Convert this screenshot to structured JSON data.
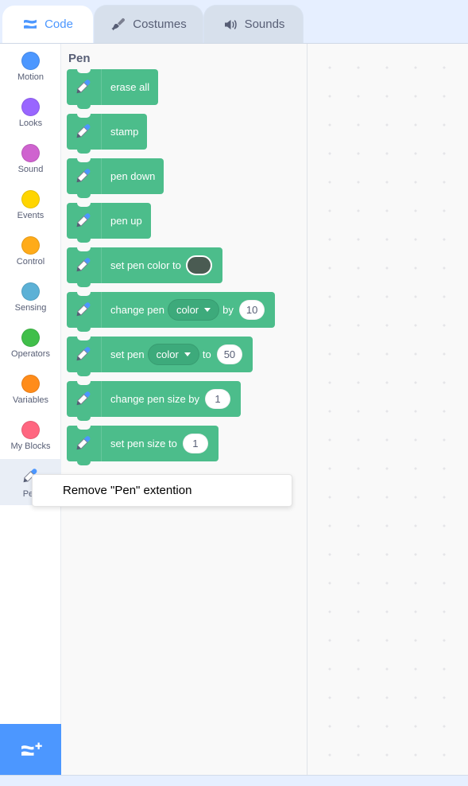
{
  "window": {
    "top_bar_color": "#e6efff",
    "accent_color": "#4c97ff",
    "pen_block_color": "#4cbd8b"
  },
  "tabs": [
    {
      "label": "Code",
      "icon": "code-blocks-icon",
      "active": true
    },
    {
      "label": "Costumes",
      "icon": "paintbrush-icon",
      "active": false
    },
    {
      "label": "Sounds",
      "icon": "speaker-icon",
      "active": false
    }
  ],
  "categories": [
    {
      "label": "Motion",
      "color": "#4c97ff",
      "icon": "circle-icon",
      "selected": false
    },
    {
      "label": "Looks",
      "color": "#9966ff",
      "icon": "circle-icon",
      "selected": false
    },
    {
      "label": "Sound",
      "color": "#cf63cf",
      "icon": "circle-icon",
      "selected": false
    },
    {
      "label": "Events",
      "color": "#ffd500",
      "icon": "circle-icon",
      "selected": false
    },
    {
      "label": "Control",
      "color": "#ffab19",
      "icon": "circle-icon",
      "selected": false
    },
    {
      "label": "Sensing",
      "color": "#5cb1d6",
      "icon": "circle-icon",
      "selected": false
    },
    {
      "label": "Operators",
      "color": "#40bf4a",
      "icon": "circle-icon",
      "selected": false
    },
    {
      "label": "Variables",
      "color": "#ff8c1a",
      "icon": "circle-icon",
      "selected": false
    },
    {
      "label": "My Blocks",
      "color": "#ff6680",
      "icon": "circle-icon",
      "selected": false
    },
    {
      "label": "Pen",
      "color": "#4cbd8b",
      "icon": "pen-icon",
      "selected": true
    }
  ],
  "add_extension_button": {
    "icon": "add-extension-icon",
    "label": ""
  },
  "palette": {
    "title": "Pen",
    "blocks": [
      {
        "name": "erase-all",
        "label": "erase all"
      },
      {
        "name": "stamp",
        "label": "stamp"
      },
      {
        "name": "pen-down",
        "label": "pen down"
      },
      {
        "name": "pen-up",
        "label": "pen up"
      },
      {
        "name": "set-pen-color-to",
        "label": "set pen color to",
        "swatch": "#4a5b52"
      },
      {
        "name": "change-pen-by",
        "label_a": "change pen",
        "dropdown": "color",
        "label_b": "by",
        "value": "10"
      },
      {
        "name": "set-pen-to",
        "label_a": "set pen",
        "dropdown": "color",
        "label_b": "to",
        "value": "50"
      },
      {
        "name": "change-pen-size-by",
        "label_a": "change pen size by",
        "value": "1"
      },
      {
        "name": "set-pen-size-to",
        "label_a": "set pen size to",
        "value": "1"
      }
    ]
  },
  "context_menu": {
    "items": [
      {
        "label": "Remove \"Pen\" extention"
      }
    ]
  }
}
